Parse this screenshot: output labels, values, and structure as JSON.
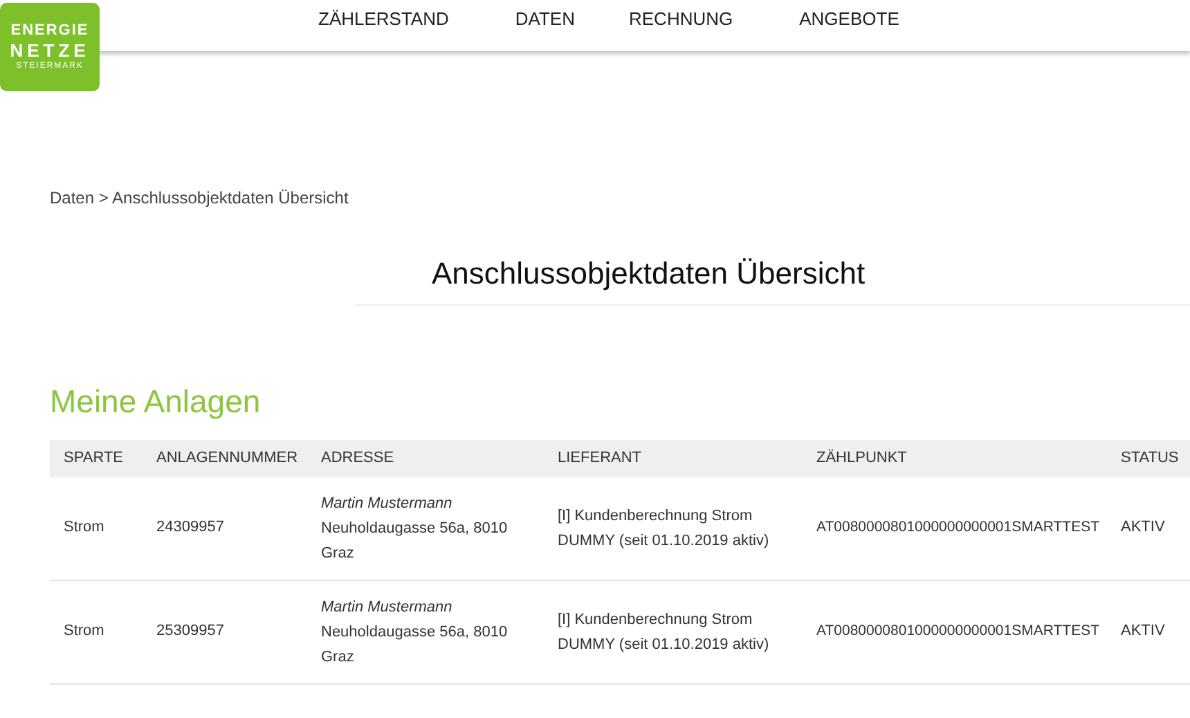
{
  "logo": {
    "line_1": "ENERGIE",
    "line_2": "NETZE",
    "line_3": "STEIERMARK"
  },
  "nav": [
    "ZÄHLERSTAND",
    "DATEN",
    "RECHNUNG",
    "ANGEBOTE"
  ],
  "breadcrumb": "Daten > Anschlussobjektdaten Übersicht",
  "title": "Anschlussobjektdaten Übersicht",
  "section_title": "Meine Anlagen",
  "table": {
    "columns": [
      "SPARTE",
      "ANLAGENNUMMER",
      "ADRESSE",
      "LIEFERANT",
      "ZÄHLPUNKT",
      "STATUS"
    ],
    "rows": [
      {
        "sparte": "Strom",
        "anlagennummer": "24309957",
        "name": "Martin Mustermann",
        "street": "Neuholdaugasse 56a, 8010 Graz",
        "lieferant": "[I] Kundenberechnung Strom DUMMY (seit 01.10.2019 aktiv)",
        "zaehlpunkt": "AT0080000801000000000001SMARTTEST",
        "status": "AKTIV"
      },
      {
        "sparte": "Strom",
        "anlagennummer": "25309957",
        "name": "Martin Mustermann",
        "street": "Neuholdaugasse 56a, 8010 Graz",
        "lieferant": "[I] Kundenberechnung Strom DUMMY (seit 01.10.2019 aktiv)",
        "zaehlpunkt": "AT0080000801000000000001SMARTTEST",
        "status": "AKTIV"
      }
    ]
  }
}
